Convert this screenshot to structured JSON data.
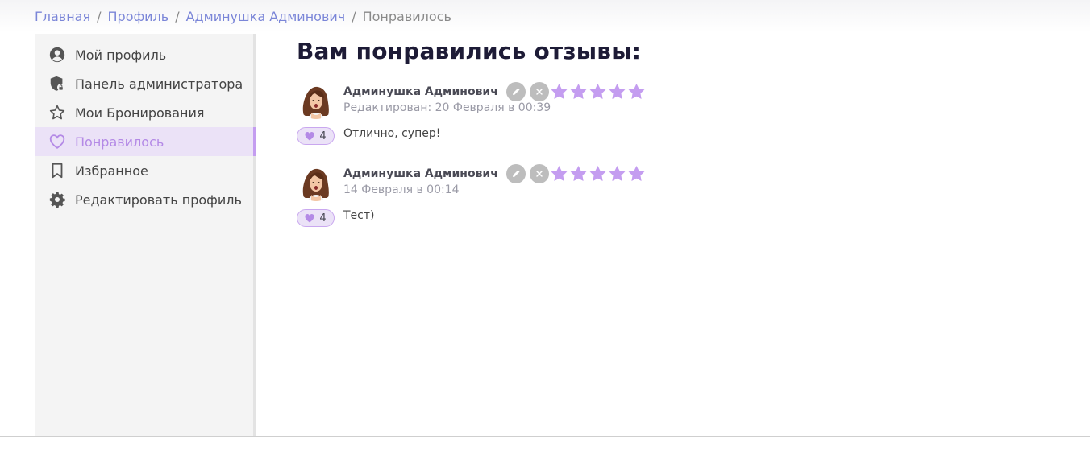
{
  "breadcrumb": {
    "items": [
      "Главная",
      "Профиль",
      "Админушка Админович"
    ],
    "separator": "/",
    "current": "Понравилось"
  },
  "sidebar": {
    "items": [
      {
        "label": "Мой профиль",
        "icon": "user-circle-icon",
        "active": false
      },
      {
        "label": "Панель администратора",
        "icon": "shield-lock-icon",
        "active": false
      },
      {
        "label": "Мои Бронирования",
        "icon": "star-outline-icon",
        "active": false
      },
      {
        "label": "Понравилось",
        "icon": "heart-outline-icon",
        "active": true
      },
      {
        "label": "Избранное",
        "icon": "bookmark-icon",
        "active": false
      },
      {
        "label": "Редактировать профиль",
        "icon": "gear-icon",
        "active": false
      }
    ]
  },
  "main": {
    "title": "Вам понравились отзывы:",
    "reviews": [
      {
        "author": "Админушка Админович",
        "date": "Редактирован: 20 Февраля в 00:39",
        "rating": 5,
        "likes": "4",
        "text": "Отлично, супер!"
      },
      {
        "author": "Админушка Админович",
        "date": "14 Февраля в 00:14",
        "rating": 5,
        "likes": "4",
        "text": "Тест)"
      }
    ]
  },
  "colors": {
    "accent": "#b48ae6",
    "star": "#c49df0",
    "link": "#7b86d8",
    "title": "#1d1b36",
    "active_bg": "#ebe2f7"
  }
}
